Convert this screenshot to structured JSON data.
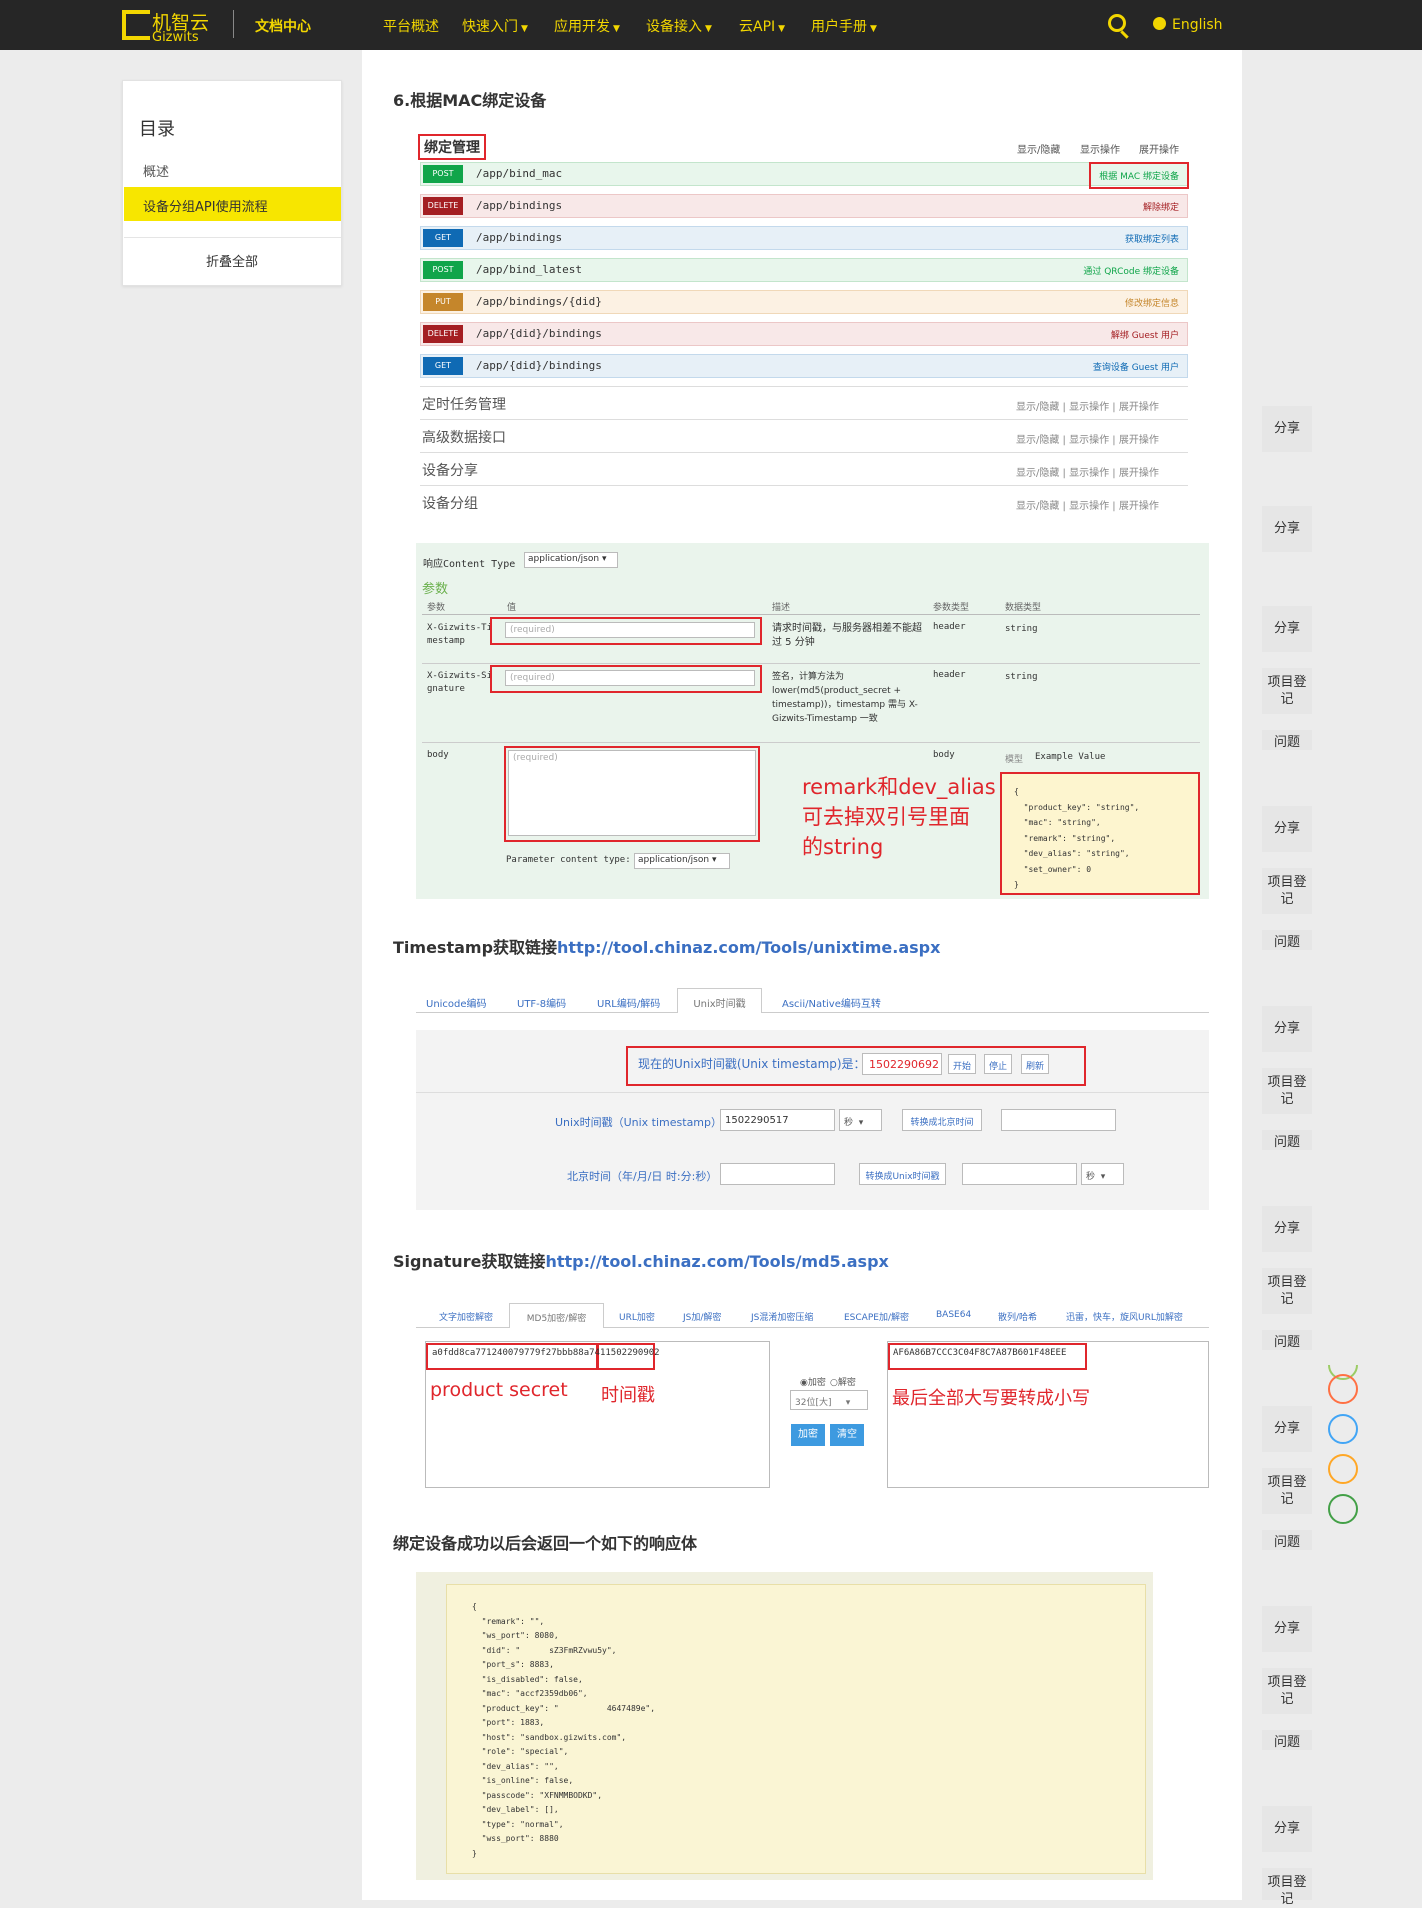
{
  "topbar": {
    "logo_cn": "机智云",
    "logo_en": "Gizwits",
    "doc_center": "文档中心",
    "nav": [
      {
        "label": "平台概述",
        "caret": ""
      },
      {
        "label": "快速入门",
        "caret": "▼"
      },
      {
        "label": "应用开发",
        "caret": "▼"
      },
      {
        "label": "设备接入",
        "caret": "▼"
      },
      {
        "label": "云API",
        "caret": "▼"
      },
      {
        "label": "用户手册",
        "caret": "▼"
      }
    ],
    "language": "English",
    "icons": {
      "search": "search-icon",
      "globe": "globe-icon"
    }
  },
  "toc": {
    "title": "目录",
    "items": [
      "概述",
      "设备分组API使用流程"
    ],
    "fold": "折叠全部"
  },
  "section6": {
    "heading": "6.根据MAC绑定设备",
    "group_title": "绑定管理",
    "header_ops": [
      "显示/隐藏",
      "显示操作",
      "展开操作"
    ],
    "endpoints": [
      {
        "verb": "POST",
        "path": "/app/bind_mac",
        "desc": "根据 MAC 绑定设备"
      },
      {
        "verb": "DELETE",
        "path": "/app/bindings",
        "desc": "解除绑定"
      },
      {
        "verb": "GET",
        "path": "/app/bindings",
        "desc": "获取绑定列表"
      },
      {
        "verb": "POST",
        "path": "/app/bind_latest",
        "desc": "通过 QRCode 绑定设备"
      },
      {
        "verb": "PUT",
        "path": "/app/bindings/{did}",
        "desc": "修改绑定信息"
      },
      {
        "verb": "DELETE",
        "path": "/app/{did}/bindings",
        "desc": "解绑 Guest 用户"
      },
      {
        "verb": "GET",
        "path": "/app/{did}/bindings",
        "desc": "查询设备 Guest 用户"
      }
    ],
    "groups": [
      "定时任务管理",
      "高级数据接口",
      "设备分享",
      "设备分组"
    ],
    "group_ops": "显示/隐藏  |  显示操作  |  展开操作"
  },
  "form": {
    "content_type_label": "响应Content Type",
    "content_type_value": "application/json",
    "params_title": "参数",
    "columns": [
      "参数",
      "值",
      "描述",
      "参数类型",
      "数据类型"
    ],
    "rows": [
      {
        "name": "X-Gizwits-Timestamp",
        "placeholder": "(required)",
        "desc": "请求时间戳，与服务器相差不能超过 5 分钟",
        "ptype": "header",
        "dtype": "string"
      },
      {
        "name": "X-Gizwits-Signature",
        "placeholder": "(required)",
        "desc": "签名，计算方法为 lower(md5(product_secret + timestamp))，timestamp 需与 X-Gizwits-Timestamp 一致",
        "ptype": "header",
        "dtype": "string"
      },
      {
        "name": "body",
        "placeholder": "(required)",
        "desc": "",
        "ptype": "body",
        "dtype": ""
      }
    ],
    "model_label": "模型",
    "example_label": "Example Value",
    "param_ct_label": "Parameter content type:",
    "param_ct_value": "application/json",
    "annotation": [
      "remark和dev_alias",
      "可去掉双引号里面",
      "的string"
    ],
    "example_lines": [
      "{",
      "  \"product_key\": \"string\",",
      "  \"mac\": \"string\",",
      "  \"remark\": \"string\",",
      "  \"dev_alias\": \"string\",",
      "  \"set_owner\": 0",
      "}"
    ]
  },
  "timestamp": {
    "heading_prefix": "Timestamp获取链接",
    "link": "http://tool.chinaz.com/Tools/unixtime.aspx",
    "tabs": [
      "Unicode编码",
      "UTF-8编码",
      "URL编码/解码",
      "Unix时间戳",
      "Ascii/Native编码互转"
    ],
    "now_label": "现在的Unix时间戳(Unix timestamp)是：",
    "now_value": "1502290692",
    "btn_start": "开始",
    "btn_stop": "停止",
    "btn_refresh": "刷新",
    "row1_label": "Unix时间戳（Unix timestamp）",
    "row1_value": "1502290517",
    "row1_unit": "秒",
    "row1_btn": "转换成北京时间",
    "row2_label": "北京时间（年/月/日 时:分:秒）",
    "row2_btn": "转换成Unix时间戳",
    "row2_unit": "秒"
  },
  "signature": {
    "heading_prefix": "Signature获取链接",
    "link": "http://tool.chinaz.com/Tools/md5.aspx",
    "tabs": [
      "文字加密解密",
      "MD5加密/解密",
      "URL加密",
      "JS加/解密",
      "JS混淆加密压缩",
      "ESCAPE加/解密",
      "BASE64",
      "散列/哈希",
      "迅雷，快车，旋风URL加解密"
    ],
    "input_value": "a0fdd8ca771240079779f27bbb88a7411502290902",
    "label_secret": "product secret",
    "label_time": "时间戳",
    "radio_encrypt": "◉加密",
    "radio_decrypt": "○解密",
    "select_value": "32位[大]",
    "btn_encrypt": "加密",
    "btn_clear": "清空",
    "output_value": "AF6A86B7CCC3C04F8C7A87B601F48EEE",
    "note": "最后全部大写要转成小写"
  },
  "response": {
    "heading": "绑定设备成功以后会返回一个如下的响应体",
    "lines": [
      "{",
      "  \"remark\": \"\",",
      "  \"ws_port\": 8080,",
      "  \"did\": \"      sZ3FmRZvwu5y\",",
      "  \"port_s\": 8883,",
      "  \"is_disabled\": false,",
      "  \"mac\": \"accf2359db06\",",
      "  \"product_key\": \"          4647489e\",",
      "  \"port\": 1883,",
      "  \"host\": \"sandbox.gizwits.com\",",
      "  \"role\": \"special\",",
      "  \"dev_alias\": \"\",",
      "  \"is_online\": false,",
      "  \"passcode\": \"XFNMMBODKD\",",
      "  \"dev_label\": [],",
      "  \"type\": \"normal\",",
      "  \"wss_port\": 8880",
      "}"
    ]
  },
  "side": {
    "share": "分享",
    "register": "项目登记",
    "question": "问题"
  },
  "colors": {
    "accent": "#f2d600",
    "red_mark": "#e0262c",
    "link": "#3b6fc2"
  }
}
